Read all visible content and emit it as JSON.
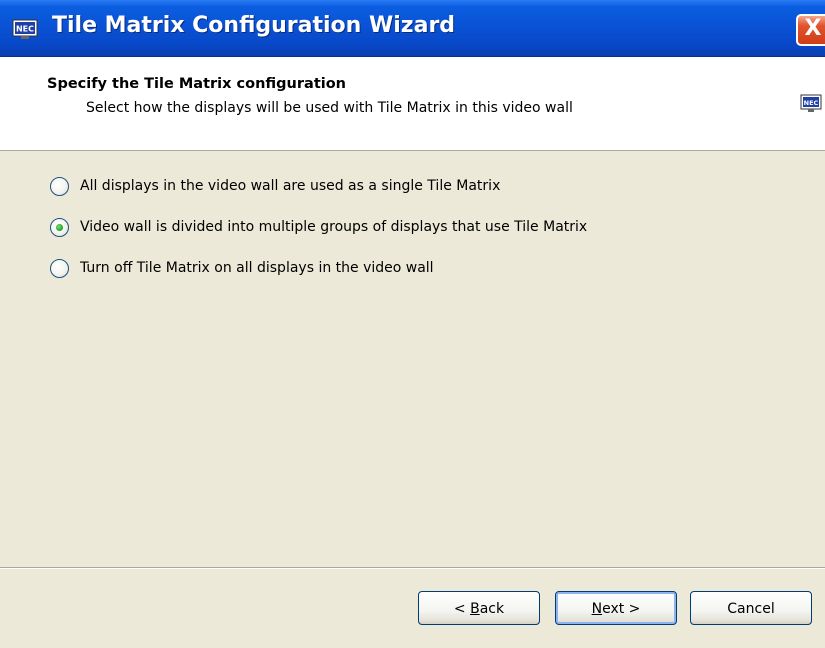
{
  "window": {
    "title": "Tile Matrix Configuration Wizard",
    "close_label": "X",
    "icon": "nec-monitor-icon"
  },
  "header": {
    "title": "Specify the Tile Matrix configuration",
    "subtitle": "Select how the displays will be used with Tile Matrix in this video wall",
    "icon": "nec-monitor-icon"
  },
  "options": [
    {
      "label": "All displays in the video wall are used as a single Tile Matrix",
      "selected": false
    },
    {
      "label": "Video wall is divided into multiple groups of displays that use Tile Matrix",
      "selected": true
    },
    {
      "label": "Turn off Tile Matrix on all displays in the video wall",
      "selected": false
    }
  ],
  "buttons": {
    "back": {
      "prefix": "< ",
      "mnemonic": "B",
      "rest": "ack"
    },
    "next": {
      "mnemonic": "N",
      "rest": "ext >"
    },
    "cancel": {
      "label": "Cancel"
    }
  },
  "colors": {
    "titlebar": "#0A52D6",
    "dialog_bg": "#ECE9D8",
    "radio_dot": "#2BA52B",
    "close_button": "#CF3E18"
  }
}
